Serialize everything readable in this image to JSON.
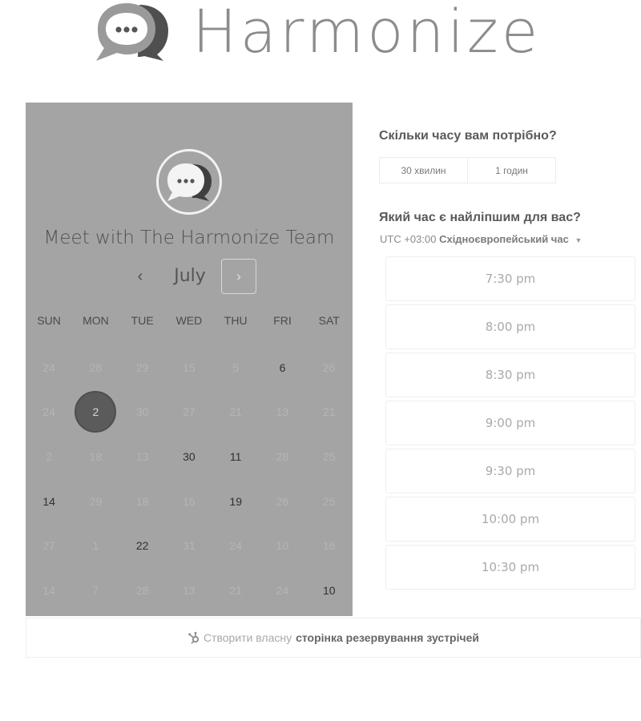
{
  "header": {
    "brand": "Harmonize",
    "logo_icon": "chat-bubble-icon"
  },
  "calendar": {
    "meeting_title": "Meet with The Harmonize Team",
    "month": "July",
    "prev_icon": "chevron-left-icon",
    "next_icon": "chevron-right-icon",
    "prev_label": "‹",
    "next_label": "›",
    "weekdays": [
      "SUN",
      "MON",
      "TUE",
      "WED",
      "THU",
      "FRI",
      "SAT"
    ],
    "weeks": [
      [
        {
          "d": "24",
          "a": false
        },
        {
          "d": "28",
          "a": false
        },
        {
          "d": "29",
          "a": false
        },
        {
          "d": "15",
          "a": false
        },
        {
          "d": "5",
          "a": false
        },
        {
          "d": "6",
          "a": true
        },
        {
          "d": "26",
          "a": false
        }
      ],
      [
        {
          "d": "24",
          "a": false
        },
        {
          "d": "2",
          "a": true,
          "selected": true
        },
        {
          "d": "30",
          "a": false
        },
        {
          "d": "27",
          "a": false
        },
        {
          "d": "21",
          "a": false
        },
        {
          "d": "13",
          "a": false
        },
        {
          "d": "21",
          "a": false
        }
      ],
      [
        {
          "d": "2",
          "a": false
        },
        {
          "d": "18",
          "a": false
        },
        {
          "d": "13",
          "a": false
        },
        {
          "d": "30",
          "a": true
        },
        {
          "d": "11",
          "a": true
        },
        {
          "d": "28",
          "a": false
        },
        {
          "d": "25",
          "a": false
        }
      ],
      [
        {
          "d": "14",
          "a": true
        },
        {
          "d": "29",
          "a": false
        },
        {
          "d": "18",
          "a": false
        },
        {
          "d": "15",
          "a": false
        },
        {
          "d": "19",
          "a": true
        },
        {
          "d": "26",
          "a": false
        },
        {
          "d": "25",
          "a": false
        }
      ],
      [
        {
          "d": "27",
          "a": false
        },
        {
          "d": "1",
          "a": false
        },
        {
          "d": "22",
          "a": true
        },
        {
          "d": "31",
          "a": false
        },
        {
          "d": "24",
          "a": false
        },
        {
          "d": "10",
          "a": false
        },
        {
          "d": "16",
          "a": false
        }
      ],
      [
        {
          "d": "14",
          "a": false
        },
        {
          "d": "7",
          "a": false
        },
        {
          "d": "28",
          "a": false
        },
        {
          "d": "13",
          "a": false
        },
        {
          "d": "21",
          "a": false
        },
        {
          "d": "24",
          "a": false
        },
        {
          "d": "10",
          "a": true
        }
      ]
    ]
  },
  "duration": {
    "heading": "Скільки часу вам потрібно?",
    "options": [
      "30 хвилин",
      "1 годин"
    ]
  },
  "time": {
    "heading": "Який час є найліпшим для вас?",
    "tz_offset": "UTC +03:00",
    "tz_name": "Східноєвропейський час",
    "slots": [
      "7:30 pm",
      "8:00 pm",
      "8:30 pm",
      "9:00 pm",
      "9:30 pm",
      "10:00 pm",
      "10:30 pm"
    ]
  },
  "footer": {
    "icon": "hubspot-sprocket-icon",
    "text_plain": "Створити власну",
    "text_bold": "сторінка резервування зустрічей"
  },
  "colors": {
    "panel_bg": "#a4a4a4",
    "selected_day": "#5b5b5b",
    "brand_text": "#8c8c8c"
  }
}
